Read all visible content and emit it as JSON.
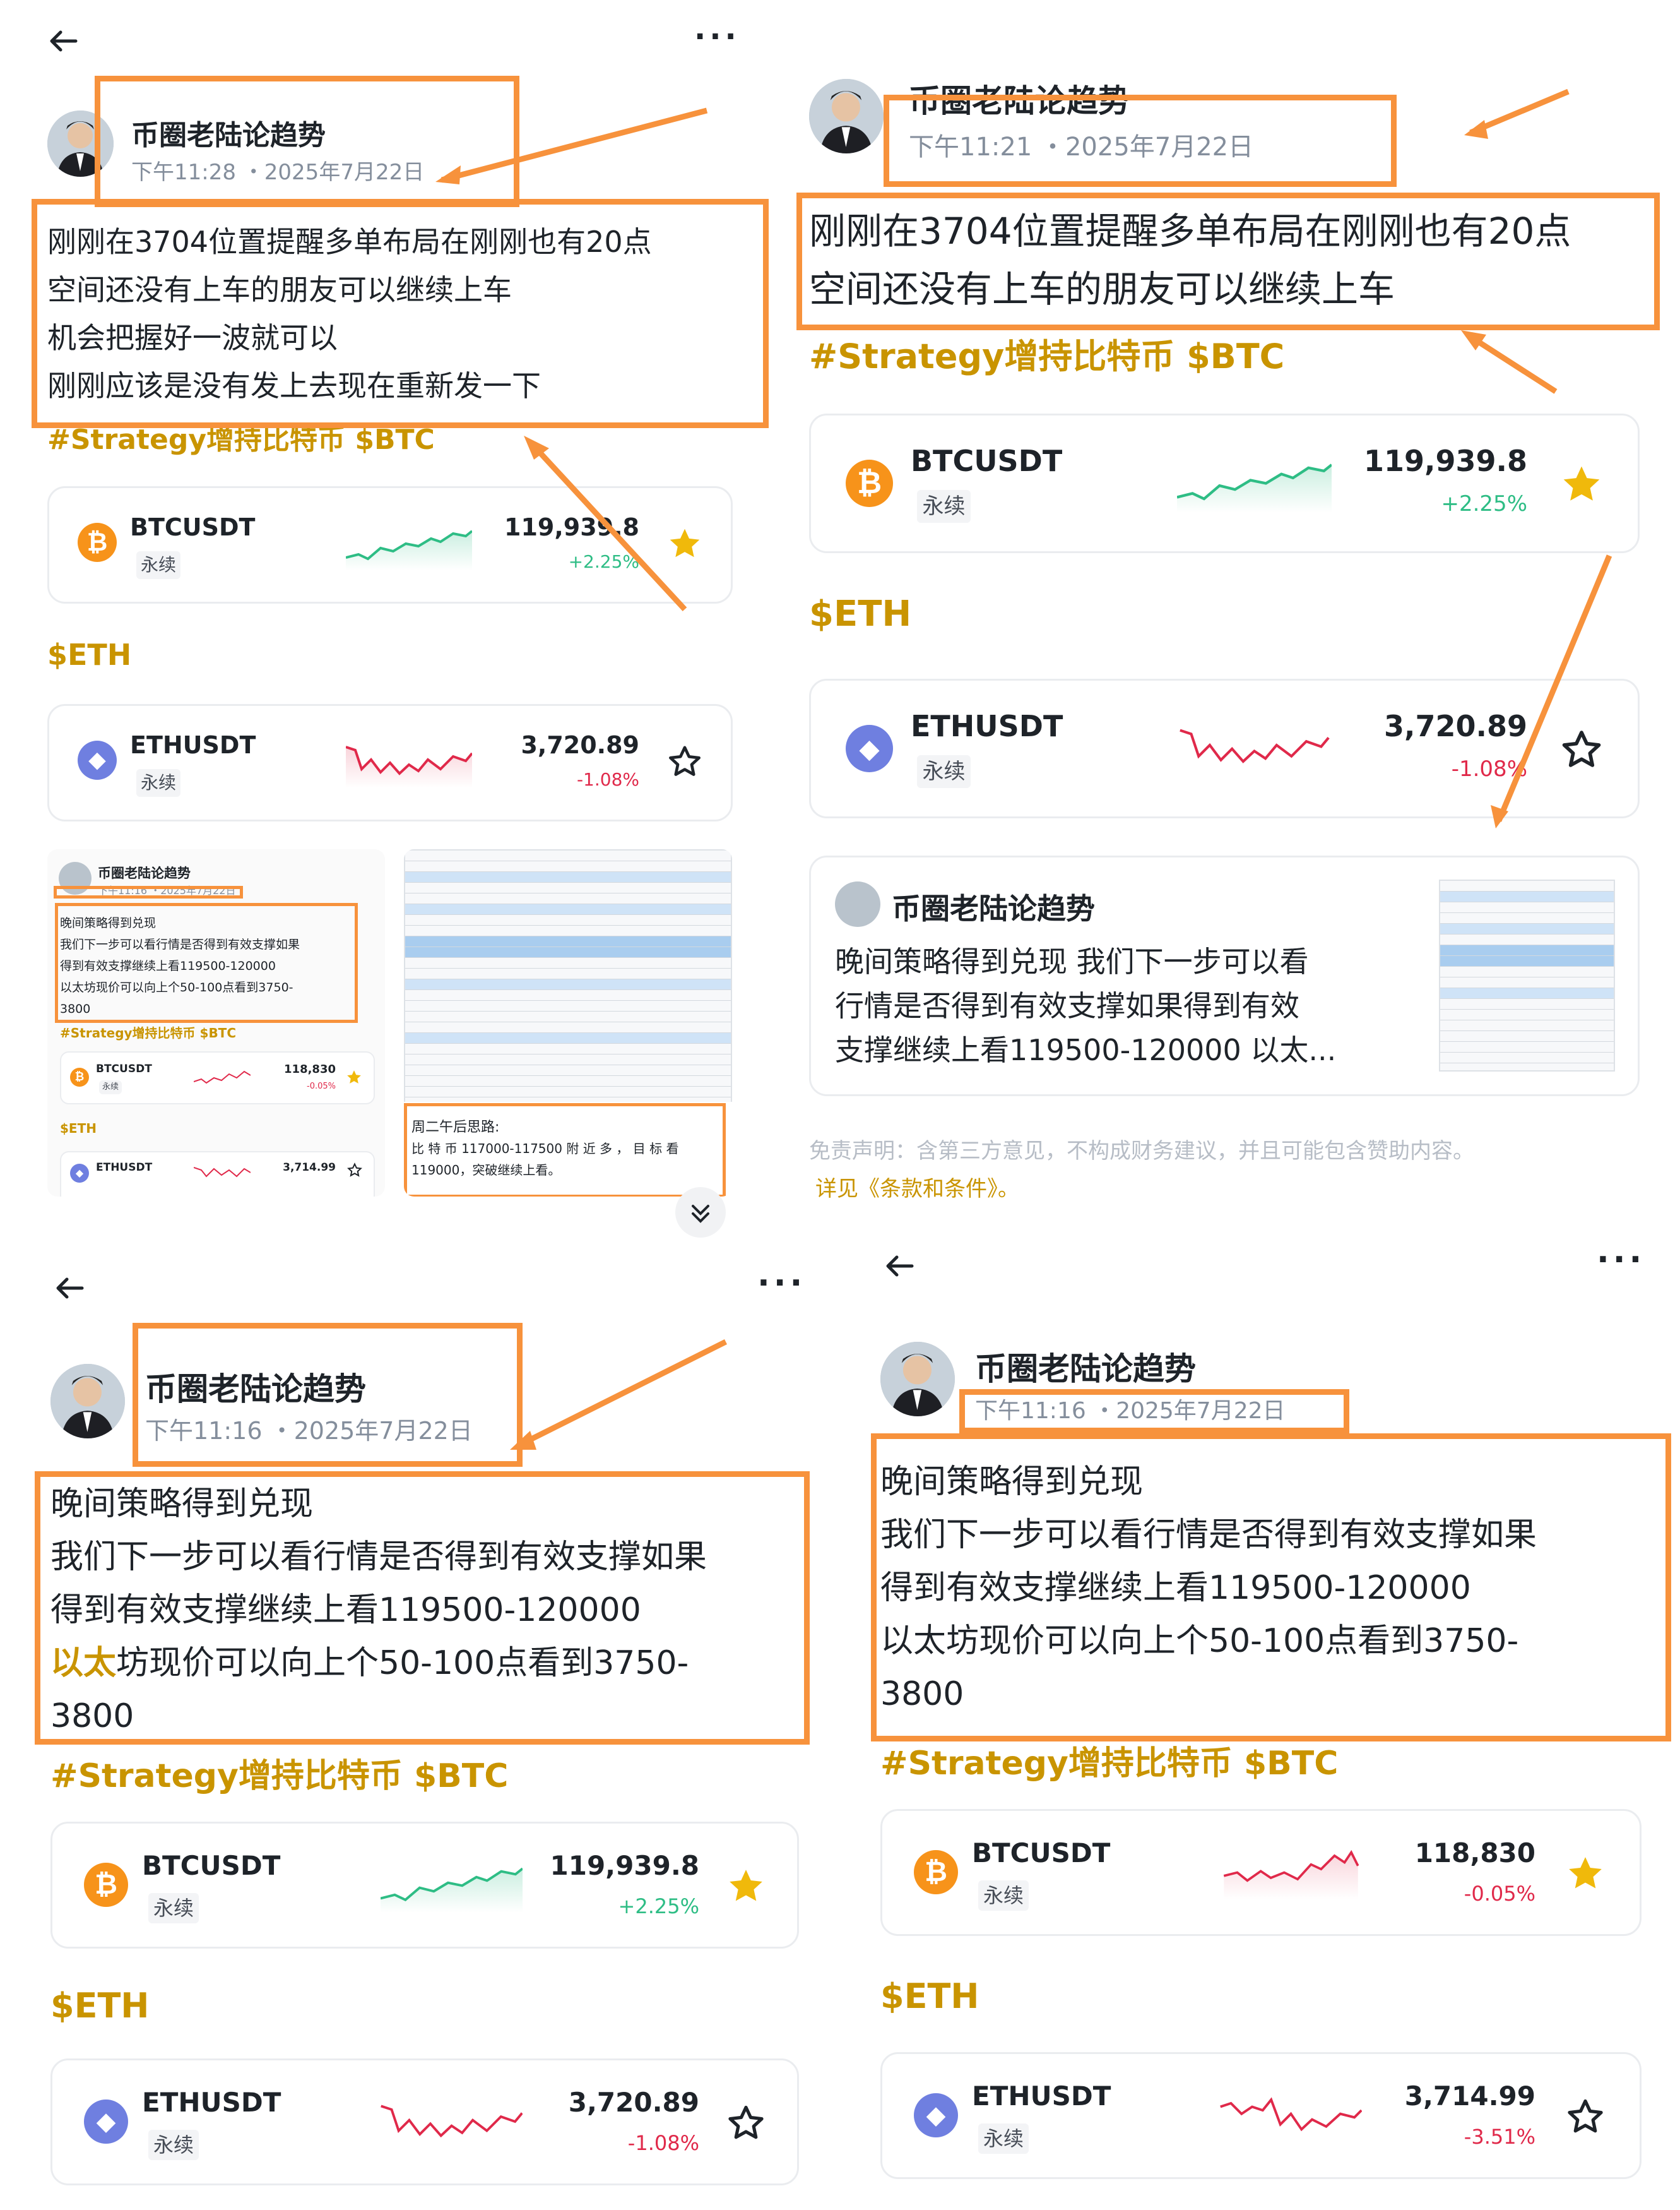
{
  "panels": [
    {
      "author": "币圈老陆论趋势",
      "time": "下午11:28 ・2025年7月22日",
      "body_lines": [
        "刚刚在3704位置提醒多单布局在刚刚也有20点",
        "空间还没有上车的朋友可以继续上车",
        "机会把握好一波就可以",
        "刚刚应该是没有发上去现在重新发一下"
      ],
      "hashtag": "#Strategy增持比特币 $BTC",
      "btc": {
        "symbol": "BTCUSDT",
        "type": "永续",
        "price": "119,939.8",
        "change": "+2.25%",
        "starred": true
      },
      "eth_tag": "$ETH",
      "eth": {
        "symbol": "ETHUSDT",
        "type": "永续",
        "price": "3,720.89",
        "change": "-1.08%",
        "starred": false
      },
      "mini_post": {
        "author": "币圈老陆论趋势",
        "time": "下午11:16 ・2025年7月22日",
        "lines": [
          "晚间策略得到兑现",
          "我们下一步可以看行情是否得到有效支撑如果",
          "得到有效支撑继续上看119500-120000",
          "以太坊现价可以向上个50-100点看到3750-",
          "3800"
        ],
        "hashtag": "#Strategy增持比特币 $BTC",
        "btc": {
          "symbol": "BTCUSDT",
          "type": "永续",
          "price": "118,830",
          "change": "-0.05%"
        },
        "eth_tag": "$ETH",
        "eth": {
          "symbol": "ETHUSDT",
          "type": "永续",
          "price": "3,714.99"
        }
      },
      "sheet_note": {
        "title": "周二午后思路:",
        "lines": [
          "比 特 币 117000-117500 附 近 多 ， 目 标 看",
          "119000，突破继续上看。"
        ]
      }
    },
    {
      "author": "币圈老陆论趋势",
      "time": "下午11:21 ・2025年7月22日",
      "body_lines": [
        "刚刚在3704位置提醒多单布局在刚刚也有20点",
        "空间还没有上车的朋友可以继续上车"
      ],
      "hashtag": "#Strategy增持比特币 $BTC",
      "btc": {
        "symbol": "BTCUSDT",
        "type": "永续",
        "price": "119,939.8",
        "change": "+2.25%",
        "starred": true
      },
      "eth_tag": "$ETH",
      "eth": {
        "symbol": "ETHUSDT",
        "type": "永续",
        "price": "3,720.89",
        "change": "-1.08%",
        "starred": false
      },
      "quote": {
        "author": "币圈老陆论趋势",
        "lines": [
          "晚间策略得到兑现 我们下一步可以看",
          "行情是否得到有效支撑如果得到有效",
          "支撑继续上看119500-120000 以太..."
        ]
      },
      "disclaimer": "免责声明：含第三方意见，不构成财务建议，并且可能包含赞助内容。",
      "terms": "详见《条款和条件》。"
    },
    {
      "author": "币圈老陆论趋势",
      "time": "下午11:16 ・2025年7月22日",
      "body_lines": [
        "晚间策略得到兑现",
        "我们下一步可以看行情是否得到有效支撑如果",
        "得到有效支撑继续上看119500-120000"
      ],
      "body_last_highlight": "以太",
      "body_last_rest": "坊现价可以向上个50-100点看到3750-",
      "body_tail": "3800",
      "hashtag": "#Strategy增持比特币 $BTC",
      "btc": {
        "symbol": "BTCUSDT",
        "type": "永续",
        "price": "119,939.8",
        "change": "+2.25%",
        "starred": true
      },
      "eth_tag": "$ETH",
      "eth": {
        "symbol": "ETHUSDT",
        "type": "永续",
        "price": "3,720.89",
        "change": "-1.08%",
        "starred": false
      }
    },
    {
      "author": "币圈老陆论趋势",
      "time": "下午11:16 ・2025年7月22日",
      "body_lines": [
        "晚间策略得到兑现",
        "我们下一步可以看行情是否得到有效支撑如果",
        "得到有效支撑继续上看119500-120000",
        "以太坊现价可以向上个50-100点看到3750-",
        "3800"
      ],
      "hashtag": "#Strategy增持比特币 $BTC",
      "btc": {
        "symbol": "BTCUSDT",
        "type": "永续",
        "price": "118,830",
        "change": "-0.05%",
        "starred": true
      },
      "eth_tag": "$ETH",
      "eth": {
        "symbol": "ETHUSDT",
        "type": "永续",
        "price": "3,714.99",
        "change": "-3.51%",
        "starred": false
      }
    }
  ],
  "icons": {
    "back": "arrow-left-icon",
    "more": "more-dots-icon",
    "star": "star-icon",
    "expand": "chevron-double-down-icon"
  },
  "colors": {
    "accent": "#f7923c",
    "gold": "#c99400",
    "up": "#2ebd85",
    "down": "#e0294a",
    "btc": "#f7931a",
    "eth": "#6f7fe0"
  }
}
